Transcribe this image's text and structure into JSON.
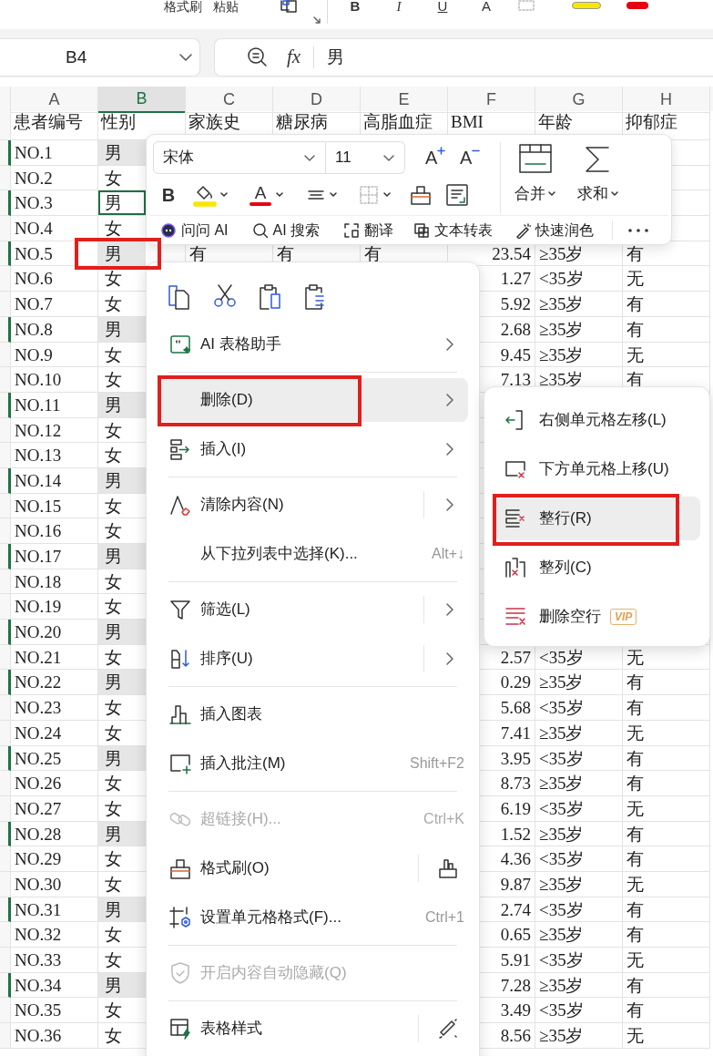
{
  "ribbon": {
    "labels": [
      "格式刷",
      "粘贴"
    ],
    "buttons": [
      "B",
      "I",
      "U",
      "A"
    ]
  },
  "name_box": {
    "value": "B4"
  },
  "formula_bar": {
    "function_label": "fx",
    "value": "男"
  },
  "columns": [
    {
      "label": "A",
      "selected": false
    },
    {
      "label": "B",
      "selected": true
    },
    {
      "label": "C",
      "selected": false
    },
    {
      "label": "D",
      "selected": false
    },
    {
      "label": "E",
      "selected": false
    },
    {
      "label": "F",
      "selected": false
    },
    {
      "label": "G",
      "selected": false
    },
    {
      "label": "H",
      "selected": false
    }
  ],
  "header": [
    "患者编号",
    "性别",
    "家族史",
    "糖尿病",
    "高脂血症",
    "BMI",
    "年龄",
    "抑郁症"
  ],
  "rows": [
    {
      "A": "NO.1",
      "B": "男",
      "selected": true,
      "active": false,
      "annotated": false
    },
    {
      "A": "NO.2",
      "B": "女",
      "selected": false,
      "active": false,
      "annotated": false
    },
    {
      "A": "NO.3",
      "B": "男",
      "selected": true,
      "active": true,
      "annotated": false
    },
    {
      "A": "NO.4",
      "B": "女",
      "selected": false,
      "active": false,
      "annotated": false
    },
    {
      "A": "NO.5",
      "B": "男",
      "C": "有",
      "D": "有",
      "E": "有",
      "F": "23.54",
      "G": "≥35岁",
      "H": "有",
      "selected": true,
      "active": false,
      "annotated": true
    },
    {
      "A": "NO.6",
      "B": "女",
      "F": "1.27",
      "G": "<35岁",
      "H": "无",
      "selected": false,
      "active": false,
      "annotated": false
    },
    {
      "A": "NO.7",
      "B": "女",
      "F": "5.92",
      "G": "≥35岁",
      "H": "有",
      "selected": false,
      "active": false,
      "annotated": false
    },
    {
      "A": "NO.8",
      "B": "男",
      "F": "2.68",
      "G": "≥35岁",
      "H": "有",
      "selected": true,
      "active": false,
      "annotated": false
    },
    {
      "A": "NO.9",
      "B": "女",
      "F": "9.45",
      "G": "≥35岁",
      "H": "无",
      "selected": false,
      "active": false,
      "annotated": false
    },
    {
      "A": "NO.10",
      "B": "女",
      "F": "7.13",
      "G": "≥35岁",
      "H": "有",
      "selected": false,
      "active": false,
      "annotated": false
    },
    {
      "A": "NO.11",
      "B": "男",
      "selected": true,
      "active": false,
      "annotated": false
    },
    {
      "A": "NO.12",
      "B": "女",
      "selected": false,
      "active": false,
      "annotated": false
    },
    {
      "A": "NO.13",
      "B": "女",
      "selected": false,
      "active": false,
      "annotated": false
    },
    {
      "A": "NO.14",
      "B": "男",
      "selected": true,
      "active": false,
      "annotated": false
    },
    {
      "A": "NO.15",
      "B": "女",
      "selected": false,
      "active": false,
      "annotated": false
    },
    {
      "A": "NO.16",
      "B": "女",
      "selected": false,
      "active": false,
      "annotated": false
    },
    {
      "A": "NO.17",
      "B": "男",
      "selected": true,
      "active": false,
      "annotated": false
    },
    {
      "A": "NO.18",
      "B": "女",
      "selected": false,
      "active": false,
      "annotated": false
    },
    {
      "A": "NO.19",
      "B": "女",
      "selected": false,
      "active": false,
      "annotated": false
    },
    {
      "A": "NO.20",
      "B": "男",
      "selected": true,
      "active": false,
      "annotated": false
    },
    {
      "A": "NO.21",
      "B": "女",
      "F": "2.57",
      "G": "<35岁",
      "H": "无",
      "selected": false,
      "active": false,
      "annotated": false
    },
    {
      "A": "NO.22",
      "B": "男",
      "F": "0.29",
      "G": "≥35岁",
      "H": "有",
      "selected": true,
      "active": false,
      "annotated": false
    },
    {
      "A": "NO.23",
      "B": "女",
      "F": "5.68",
      "G": "<35岁",
      "H": "有",
      "selected": false,
      "active": false,
      "annotated": false
    },
    {
      "A": "NO.24",
      "B": "女",
      "F": "7.41",
      "G": "≥35岁",
      "H": "无",
      "selected": false,
      "active": false,
      "annotated": false
    },
    {
      "A": "NO.25",
      "B": "男",
      "F": "3.95",
      "G": "<35岁",
      "H": "有",
      "selected": true,
      "active": false,
      "annotated": false
    },
    {
      "A": "NO.26",
      "B": "女",
      "F": "8.73",
      "G": "≥35岁",
      "H": "有",
      "selected": false,
      "active": false,
      "annotated": false
    },
    {
      "A": "NO.27",
      "B": "女",
      "F": "6.19",
      "G": "<35岁",
      "H": "无",
      "selected": false,
      "active": false,
      "annotated": false
    },
    {
      "A": "NO.28",
      "B": "男",
      "F": "1.52",
      "G": "≥35岁",
      "H": "有",
      "selected": true,
      "active": false,
      "annotated": false
    },
    {
      "A": "NO.29",
      "B": "女",
      "F": "4.36",
      "G": "<35岁",
      "H": "有",
      "selected": false,
      "active": false,
      "annotated": false
    },
    {
      "A": "NO.30",
      "B": "女",
      "F": "9.87",
      "G": "≥35岁",
      "H": "无",
      "selected": false,
      "active": false,
      "annotated": false
    },
    {
      "A": "NO.31",
      "B": "男",
      "F": "2.74",
      "G": "<35岁",
      "H": "有",
      "selected": true,
      "active": false,
      "annotated": false
    },
    {
      "A": "NO.32",
      "B": "女",
      "F": "0.65",
      "G": "≥35岁",
      "H": "有",
      "selected": false,
      "active": false,
      "annotated": false
    },
    {
      "A": "NO.33",
      "B": "女",
      "F": "5.91",
      "G": "<35岁",
      "H": "无",
      "selected": false,
      "active": false,
      "annotated": false
    },
    {
      "A": "NO.34",
      "B": "男",
      "F": "7.28",
      "G": "≥35岁",
      "H": "有",
      "selected": true,
      "active": false,
      "annotated": false
    },
    {
      "A": "NO.35",
      "B": "女",
      "F": "3.49",
      "G": "<35岁",
      "H": "有",
      "selected": false,
      "active": false,
      "annotated": false
    },
    {
      "A": "NO.36",
      "B": "女",
      "F": "8.56",
      "G": "≥35岁",
      "H": "无",
      "selected": false,
      "active": false,
      "annotated": false
    }
  ],
  "mini_toolbar": {
    "font_family": "宋体",
    "font_size": "11",
    "grow_font": "A",
    "shrink_font": "A",
    "bold": "B",
    "font_color_letter": "A",
    "merge": "合并",
    "sum": "求和",
    "ai_actions": [
      "问问 AI",
      "AI 搜索",
      "翻译",
      "文本转表",
      "快速润色"
    ]
  },
  "context_menu": {
    "items": [
      {
        "kind": "submenu",
        "label": "AI 表格助手",
        "selected": false,
        "disabled": false,
        "annotated": false
      },
      {
        "kind": "separator"
      },
      {
        "kind": "submenu",
        "label": "删除(D)",
        "selected": true,
        "disabled": false,
        "annotated": true
      },
      {
        "kind": "submenu",
        "label": "插入(I)",
        "selected": false,
        "disabled": false,
        "annotated": false
      },
      {
        "kind": "separator"
      },
      {
        "kind": "split-submenu",
        "label": "清除内容(N)",
        "selected": false,
        "disabled": false,
        "annotated": false
      },
      {
        "kind": "command",
        "label": "从下拉列表中选择(K)...",
        "shortcut": "Alt+↓",
        "selected": false,
        "disabled": false,
        "annotated": false
      },
      {
        "kind": "separator"
      },
      {
        "kind": "split-submenu",
        "label": "筛选(L)",
        "selected": false,
        "disabled": false,
        "annotated": false
      },
      {
        "kind": "split-submenu",
        "label": "排序(U)",
        "selected": false,
        "disabled": false,
        "annotated": false
      },
      {
        "kind": "separator"
      },
      {
        "kind": "command",
        "label": "插入图表",
        "selected": false,
        "disabled": false,
        "annotated": false
      },
      {
        "kind": "command",
        "label": "插入批注(M)",
        "shortcut": "Shift+F2",
        "selected": false,
        "disabled": false,
        "annotated": false
      },
      {
        "kind": "separator"
      },
      {
        "kind": "command",
        "label": "超链接(H)...",
        "shortcut": "Ctrl+K",
        "selected": false,
        "disabled": true,
        "annotated": false
      },
      {
        "kind": "split-tool",
        "label": "格式刷(O)",
        "selected": false,
        "disabled": false,
        "annotated": false
      },
      {
        "kind": "command",
        "label": "设置单元格格式(F)...",
        "shortcut": "Ctrl+1",
        "selected": false,
        "disabled": false,
        "annotated": false
      },
      {
        "kind": "separator"
      },
      {
        "kind": "command",
        "label": "开启内容自动隐藏(Q)",
        "selected": false,
        "disabled": true,
        "annotated": false
      },
      {
        "kind": "separator"
      },
      {
        "kind": "split-tool",
        "label": "表格样式",
        "selected": false,
        "disabled": false,
        "annotated": false
      }
    ]
  },
  "delete_submenu": {
    "items": [
      {
        "label": "右侧单元格左移(L)",
        "selected": false,
        "annotated": false
      },
      {
        "label": "下方单元格上移(U)",
        "selected": false,
        "annotated": false
      },
      {
        "label": "整行(R)",
        "selected": true,
        "annotated": true
      },
      {
        "label": "整列(C)",
        "selected": false,
        "annotated": false
      },
      {
        "label": "删除空行",
        "badge": "VIP",
        "selected": false,
        "annotated": false
      }
    ]
  }
}
